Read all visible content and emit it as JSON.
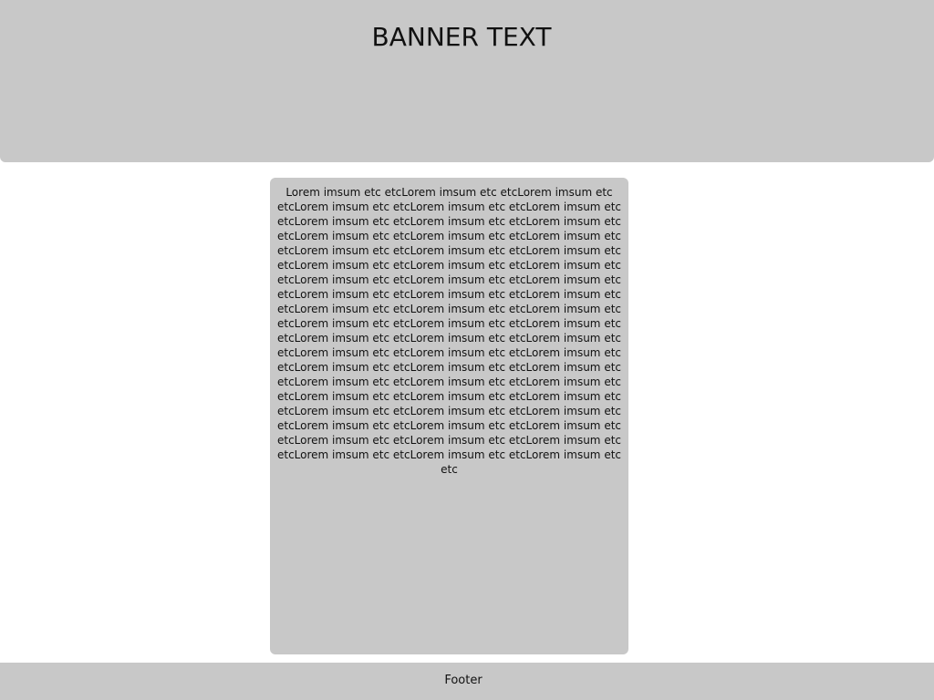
{
  "banner": {
    "title": "BANNER TEXT"
  },
  "content": {
    "body": "Lorem imsum etc etcLorem imsum etc etcLorem imsum etc etcLorem imsum etc etcLorem imsum etc etcLorem imsum etc etcLorem imsum etc etcLorem imsum etc etcLorem imsum etc etcLorem imsum etc etcLorem imsum etc etcLorem imsum etc etcLorem imsum etc etcLorem imsum etc etcLorem imsum etc etcLorem imsum etc etcLorem imsum etc etcLorem imsum etc etcLorem imsum etc etcLorem imsum etc etcLorem imsum etc etcLorem imsum etc etcLorem imsum etc etcLorem imsum etc etcLorem imsum etc etcLorem imsum etc etcLorem imsum etc etcLorem imsum etc etcLorem imsum etc etcLorem imsum etc etcLorem imsum etc etcLorem imsum etc etcLorem imsum etc etcLorem imsum etc etcLorem imsum etc etcLorem imsum etc etcLorem imsum etc etcLorem imsum etc etcLorem imsum etc etcLorem imsum etc etcLorem imsum etc etcLorem imsum etc etcLorem imsum etc etcLorem imsum etc etcLorem imsum etc etcLorem imsum etc etcLorem imsum etc etcLorem imsum etc etcLorem imsum etc etcLorem imsum etc etcLorem imsum etc etcLorem imsum etc etcLorem imsum etc etcLorem imsum etc etcLorem imsum etc etcLorem imsum etc etcLorem imsum etc etc"
  },
  "footer": {
    "label": "Footer"
  },
  "colors": {
    "panel_background": "#c8c8c8",
    "page_background": "#ffffff",
    "text": "#111111"
  }
}
